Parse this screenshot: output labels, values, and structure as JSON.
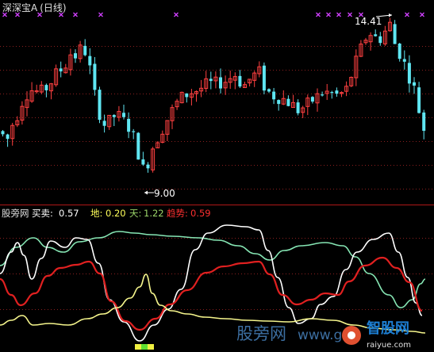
{
  "colors": {
    "background": "#000000",
    "grid": "#8a1f1f",
    "up_candle": "#ff4040",
    "down_candle": "#5fe6f2",
    "title_text": "#e0e0e0",
    "annotation": "#ffffff",
    "marker": "#d040ff",
    "separator": "#b01818",
    "label_white": "#ffffff",
    "label_yellow": "#ffff5a",
    "label_green": "#9cd66a",
    "label_red": "#ff3030",
    "line_white": "#ffffff",
    "line_yellow": "#f5f58c",
    "line_green": "#86e6b4",
    "line_red": "#e02020",
    "bar_yellow": "#f0f040",
    "bar_green": "#60e030",
    "watermark": "#3c6ea0"
  },
  "main_panel": {
    "title": "深深宝A",
    "period": "(日线)",
    "high_label": "14.41",
    "low_label": "9.00"
  },
  "indicator_panel": {
    "name": "股旁网",
    "values": [
      {
        "label": "买卖:",
        "value": "0.57",
        "color_key": "label_white"
      },
      {
        "label": "地:",
        "value": "0.20",
        "color_key": "label_yellow"
      },
      {
        "label": "天:",
        "value": "1.22",
        "color_key": "label_green"
      },
      {
        "label": "趋势:",
        "value": "0.59",
        "color_key": "label_red"
      }
    ]
  },
  "watermark": {
    "text_a": "股旁网",
    "text_b": "www.gu",
    "text_c": "智股网",
    "text_d": "raiyue.com"
  },
  "chart_data": [
    {
      "type": "candlestick",
      "title": "深深宝A (日线)",
      "annotations": [
        {
          "text": "14.41",
          "kind": "high"
        },
        {
          "text": "9.00",
          "kind": "low"
        }
      ],
      "ohlc_series": "~88 daily candles, prices derived; visible range ≈ 8.7 – 14.6",
      "ylim": [
        8.7,
        14.6
      ],
      "grid": true
    },
    {
      "type": "line",
      "title": "股旁网",
      "series": [
        {
          "name": "买卖",
          "last": 0.57
        },
        {
          "name": "地",
          "last": 0.2
        },
        {
          "name": "天",
          "last": 1.22
        },
        {
          "name": "趋势",
          "last": 0.59
        }
      ],
      "grid": true
    }
  ]
}
